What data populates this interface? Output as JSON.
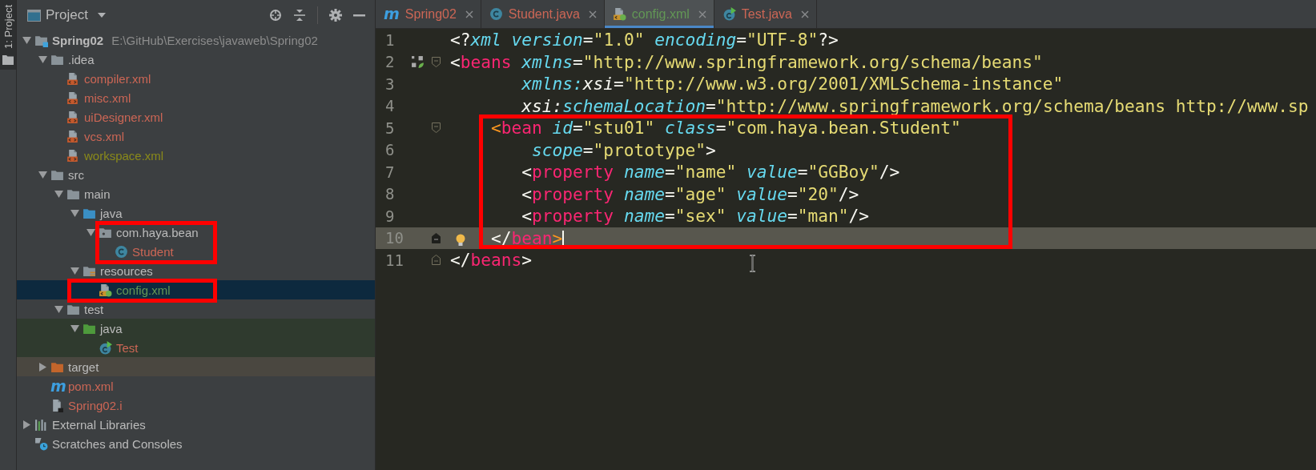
{
  "tool_stripe": {
    "label": "1: Project",
    "selected": true
  },
  "project_panel": {
    "title": "Project",
    "tree": [
      {
        "label": "Spring02",
        "path": "E:\\GitHub\\Exercises\\javaweb\\Spring02",
        "kind": "module",
        "expanded": true,
        "selected": false,
        "highlighted": false,
        "children": [
          {
            "label": ".idea",
            "kind": "folder",
            "expanded": true,
            "selected": false,
            "highlighted": false,
            "children": [
              {
                "label": "compiler.xml",
                "kind": "xml",
                "color": "#cc6655",
                "selected": false,
                "highlighted": false
              },
              {
                "label": "misc.xml",
                "kind": "xml",
                "color": "#cc6655",
                "selected": false,
                "highlighted": false
              },
              {
                "label": "uiDesigner.xml",
                "kind": "xml",
                "color": "#cc6655",
                "selected": false,
                "highlighted": false
              },
              {
                "label": "vcs.xml",
                "kind": "xml",
                "color": "#cc6655",
                "selected": false,
                "highlighted": false
              },
              {
                "label": "workspace.xml",
                "kind": "xml",
                "color": "#8a8a1a",
                "selected": false,
                "highlighted": false
              }
            ]
          },
          {
            "label": "src",
            "kind": "folder",
            "expanded": true,
            "selected": false,
            "highlighted": false,
            "children": [
              {
                "label": "main",
                "kind": "folder",
                "expanded": true,
                "selected": false,
                "highlighted": false,
                "children": [
                  {
                    "label": "java",
                    "kind": "source-folder",
                    "expanded": true,
                    "selected": false,
                    "highlighted": false,
                    "children": [
                      {
                        "label": "com.haya.bean",
                        "kind": "package",
                        "expanded": true,
                        "selected": false,
                        "highlighted": true,
                        "children": [
                          {
                            "label": "Student",
                            "kind": "class",
                            "color": "#cc6655",
                            "selected": false,
                            "highlighted": false
                          }
                        ]
                      }
                    ]
                  },
                  {
                    "label": "resources",
                    "kind": "resources-folder",
                    "expanded": true,
                    "selected": false,
                    "highlighted": false,
                    "children": [
                      {
                        "label": "config.xml",
                        "kind": "spring-xml",
                        "color": "#629755",
                        "selected": true,
                        "highlighted": true
                      }
                    ]
                  }
                ]
              },
              {
                "label": "test",
                "kind": "folder",
                "expanded": true,
                "selected": false,
                "highlighted": false,
                "children": [
                  {
                    "label": "java",
                    "kind": "test-source-folder",
                    "expanded": true,
                    "selected": false,
                    "highlighted": false,
                    "children": [
                      {
                        "label": "Test",
                        "kind": "test-class",
                        "color": "#cc6655",
                        "selected": false,
                        "highlighted": false
                      }
                    ]
                  }
                ]
              }
            ]
          },
          {
            "label": "target",
            "kind": "excluded-folder",
            "expanded": false,
            "selected": false,
            "highlighted": false
          },
          {
            "label": "pom.xml",
            "kind": "maven",
            "glyph": "m",
            "color": "#cc6655",
            "selected": false,
            "highlighted": false
          },
          {
            "label": "Spring02.i",
            "kind": "file",
            "color": "#cc6655",
            "selected": false,
            "highlighted": false
          }
        ]
      },
      {
        "label": "External Libraries",
        "kind": "libraries",
        "expanded": false,
        "selected": false,
        "highlighted": false
      },
      {
        "label": "Scratches and Consoles",
        "kind": "scratches",
        "selected": false,
        "highlighted": false
      }
    ]
  },
  "editor": {
    "tabs": [
      {
        "label": "Spring02",
        "kind": "maven",
        "glyph": "m",
        "color": "#cc6655",
        "selected": false
      },
      {
        "label": "Student.java",
        "kind": "class",
        "color": "#cc6655",
        "selected": false
      },
      {
        "label": "config.xml",
        "kind": "spring-xml",
        "color": "#629755",
        "selected": true
      },
      {
        "label": "Test.java",
        "kind": "test-class",
        "color": "#cc6655",
        "selected": false
      }
    ],
    "blocks": [
      {
        "highlighted": false,
        "lines": [
          {
            "number": "1",
            "current": false,
            "tokens": [
              {
                "kind": "punct",
                "text": "<?"
              },
              {
                "kind": "attr",
                "text": "xml"
              },
              {
                "kind": "attr",
                "text": " version"
              },
              {
                "kind": "punct",
                "text": "="
              },
              {
                "kind": "value",
                "text": "\"1.0\""
              },
              {
                "kind": "attr",
                "text": " encoding"
              },
              {
                "kind": "punct",
                "text": "="
              },
              {
                "kind": "value",
                "text": "\"UTF-8\""
              },
              {
                "kind": "punct",
                "text": "?>"
              }
            ]
          },
          {
            "number": "2",
            "current": false,
            "gutter": [
              {
                "kind": "beans"
              },
              {
                "kind": "fold-start"
              }
            ],
            "tokens": [
              {
                "kind": "punct",
                "text": "<"
              },
              {
                "kind": "tag",
                "text": "beans"
              },
              {
                "kind": "attr",
                "text": " xmlns"
              },
              {
                "kind": "punct",
                "text": "="
              },
              {
                "kind": "value",
                "text": "\"http://www.springframework.org/schema/beans\""
              }
            ]
          },
          {
            "number": "3",
            "current": false,
            "tokens": [
              {
                "kind": "attr",
                "text": "       xmlns:"
              },
              {
                "kind": "ns",
                "text": "xsi"
              },
              {
                "kind": "punct",
                "text": "="
              },
              {
                "kind": "value",
                "text": "\"http://www.w3.org/2001/XMLSchema-instance\""
              }
            ]
          },
          {
            "number": "4",
            "current": false,
            "tokens": [
              {
                "kind": "ns",
                "text": "       xsi:"
              },
              {
                "kind": "attr",
                "text": "schemaLocation"
              },
              {
                "kind": "punct",
                "text": "="
              },
              {
                "kind": "value",
                "text": "\"http://www.springframework.org/schema/beans http://www.sp"
              }
            ]
          }
        ]
      },
      {
        "highlighted": true,
        "lines": [
          {
            "number": "5",
            "current": false,
            "gutter": [
              {
                "kind": "fold-start"
              }
            ],
            "tokens": [
              {
                "kind": "match",
                "text": "    <"
              },
              {
                "kind": "tag",
                "text": "bean"
              },
              {
                "kind": "attr",
                "text": " id"
              },
              {
                "kind": "punct",
                "text": "="
              },
              {
                "kind": "value",
                "text": "\"stu01\""
              },
              {
                "kind": "attr",
                "text": " class"
              },
              {
                "kind": "punct",
                "text": "="
              },
              {
                "kind": "value",
                "text": "\"com.haya.bean.Student\""
              }
            ]
          },
          {
            "number": "6",
            "current": false,
            "tokens": [
              {
                "kind": "attr",
                "text": "        scope"
              },
              {
                "kind": "punct",
                "text": "="
              },
              {
                "kind": "value",
                "text": "\"prototype\""
              },
              {
                "kind": "punct",
                "text": ">"
              }
            ]
          },
          {
            "number": "7",
            "current": false,
            "tokens": [
              {
                "kind": "punct",
                "text": "       <"
              },
              {
                "kind": "tag",
                "text": "property"
              },
              {
                "kind": "attr",
                "text": " name"
              },
              {
                "kind": "punct",
                "text": "="
              },
              {
                "kind": "value",
                "text": "\"name\""
              },
              {
                "kind": "attr",
                "text": " value"
              },
              {
                "kind": "punct",
                "text": "="
              },
              {
                "kind": "value",
                "text": "\"GGBoy\""
              },
              {
                "kind": "punct",
                "text": "/>"
              }
            ]
          },
          {
            "number": "8",
            "current": false,
            "tokens": [
              {
                "kind": "punct",
                "text": "       <"
              },
              {
                "kind": "tag",
                "text": "property"
              },
              {
                "kind": "attr",
                "text": " name"
              },
              {
                "kind": "punct",
                "text": "="
              },
              {
                "kind": "value",
                "text": "\"age\""
              },
              {
                "kind": "attr",
                "text": " value"
              },
              {
                "kind": "punct",
                "text": "="
              },
              {
                "kind": "value",
                "text": "\"20\""
              },
              {
                "kind": "punct",
                "text": "/>"
              }
            ]
          },
          {
            "number": "9",
            "current": false,
            "tokens": [
              {
                "kind": "punct",
                "text": "       <"
              },
              {
                "kind": "tag",
                "text": "property"
              },
              {
                "kind": "attr",
                "text": " name"
              },
              {
                "kind": "punct",
                "text": "="
              },
              {
                "kind": "value",
                "text": "\"sex\""
              },
              {
                "kind": "attr",
                "text": " value"
              },
              {
                "kind": "punct",
                "text": "="
              },
              {
                "kind": "value",
                "text": "\"man\""
              },
              {
                "kind": "punct",
                "text": "/>"
              }
            ]
          },
          {
            "number": "10",
            "current": true,
            "gutter": [
              {
                "kind": "fold-end-active"
              },
              {
                "kind": "bulb"
              }
            ],
            "tokens": [
              {
                "kind": "punct",
                "text": "    </"
              },
              {
                "kind": "tag",
                "text": "bean"
              },
              {
                "kind": "match",
                "text": ">"
              }
            ]
          }
        ]
      },
      {
        "highlighted": false,
        "lines": [
          {
            "number": "11",
            "current": false,
            "gutter": [
              {
                "kind": "fold-end"
              }
            ],
            "tokens": [
              {
                "kind": "punct",
                "text": "</"
              },
              {
                "kind": "tag",
                "text": "beans"
              },
              {
                "kind": "punct",
                "text": ">"
              }
            ]
          }
        ]
      }
    ]
  }
}
